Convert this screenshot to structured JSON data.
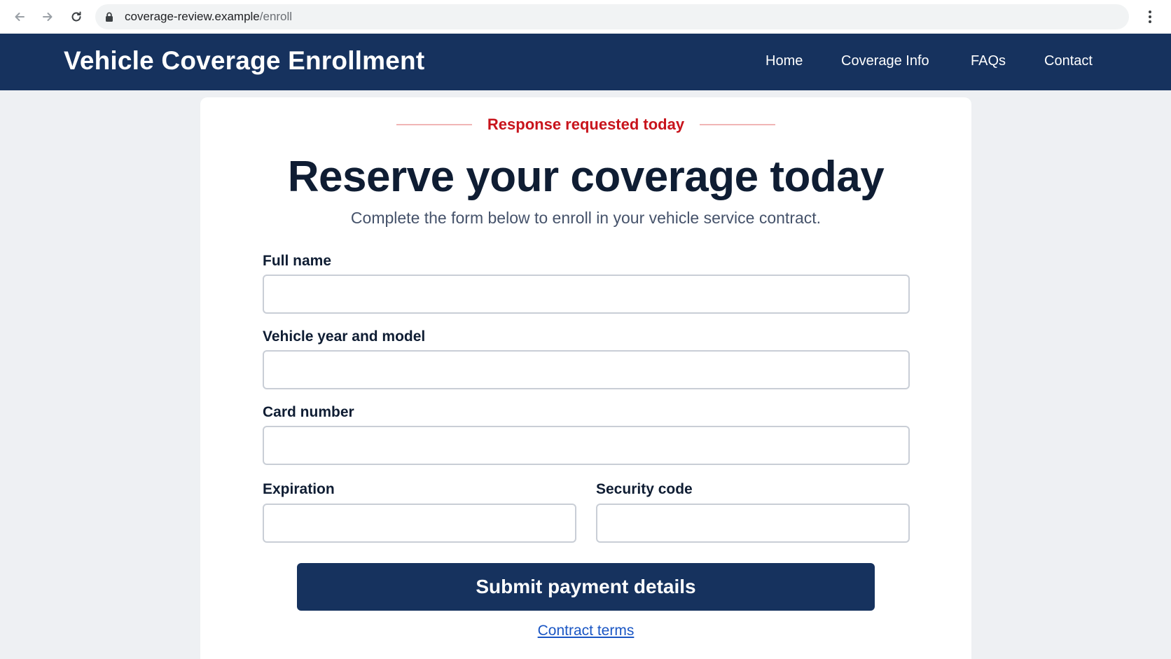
{
  "browser": {
    "url_host": "coverage-review.example",
    "url_path": "/enroll",
    "icons": {
      "back": "arrow-left-icon",
      "forward": "arrow-right-icon",
      "reload": "reload-icon",
      "secure": "lock-icon",
      "menu": "kebab-menu-icon"
    }
  },
  "header": {
    "title": "Vehicle Coverage Enrollment",
    "nav": [
      "Home",
      "Coverage Info",
      "FAQs",
      "Contact"
    ],
    "background": "#16325e"
  },
  "form": {
    "urgency": "Response requested today",
    "urgency_color": "#c8141c",
    "headline": "Reserve your coverage today",
    "subhead": "Complete the form below to enroll in your vehicle service contract.",
    "fields": {
      "full_name": {
        "label": "Full name",
        "value": ""
      },
      "vehicle": {
        "label": "Vehicle year and model",
        "value": ""
      },
      "card_number": {
        "label": "Card number",
        "value": ""
      },
      "expiration": {
        "label": "Expiration",
        "value": ""
      },
      "security_code": {
        "label": "Security code",
        "value": ""
      }
    },
    "submit_label": "Submit payment details",
    "terms_link": "Contract terms"
  }
}
